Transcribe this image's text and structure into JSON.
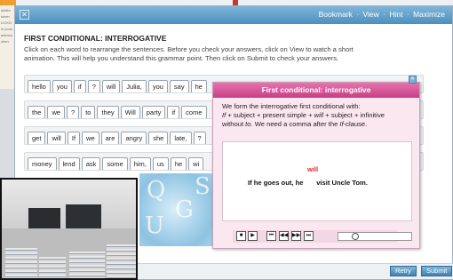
{
  "background": {
    "doc_lines": [
      "(cour",
      "addec",
      "tchen",
      "",
      "LICKO",
      "",
      "in (cour",
      "advoca",
      "chen"
    ]
  },
  "toolbar": {
    "close_glyph": "✕",
    "bookmark_label": "Bookmark",
    "view_label": "View",
    "hint_label": "Hint",
    "maximize_label": "Maximize",
    "separator": "·"
  },
  "exercise": {
    "title": "FIRST CONDITIONAL: INTERROGATIVE",
    "instructions": "Click on each word to rearrange the sentences. Before you check your answers, click on View to watch a short animation. This will help you understand this grammar point. Then click on Submit to check your answers.",
    "rows": [
      [
        "hello",
        "you",
        "if",
        "?",
        "will",
        "Julia,",
        "you",
        "say",
        "he"
      ],
      [
        "the",
        "we",
        "?",
        "to",
        "they",
        "Will",
        "party",
        "if",
        "come"
      ],
      [
        "get",
        "will",
        "If",
        "we",
        "are",
        "angry",
        "she",
        "late,",
        "?"
      ],
      [
        "money",
        "lend",
        "ask",
        "some",
        "him,",
        "us",
        "he",
        "wi"
      ]
    ]
  },
  "buttons": {
    "retry_label": "Retry",
    "submit_label": "Submit"
  },
  "popup": {
    "title": "First conditional: interrogative",
    "close_glyph": "✕",
    "intro": "We form the interrogative first conditional with:",
    "formula_if": "If",
    "formula_mid": " + subject + present simple + ",
    "formula_will": "will",
    "formula_end": " + subject + infinitive",
    "formula_line2_start": "without ",
    "formula_to": "to",
    "formula_line2_end": ". We need a comma after the ",
    "formula_if2": "If",
    "formula_line2_tail": "-clause.",
    "animation": {
      "highlight_word": "will",
      "sentence": "If he goes out, he       visit Uncle Tom."
    },
    "controls": {
      "stop_glyph": "■",
      "play_glyph": "▶",
      "first_glyph": "⏮",
      "rewind_glyph": "◀◀",
      "forward_glyph": "▶▶",
      "last_glyph": "⏭"
    },
    "progress_fraction": 0.2
  },
  "colors": {
    "titlebar_blue": "#4c8fbf",
    "popup_pink": "#c93e86",
    "highlight_red": "#e0261f"
  }
}
